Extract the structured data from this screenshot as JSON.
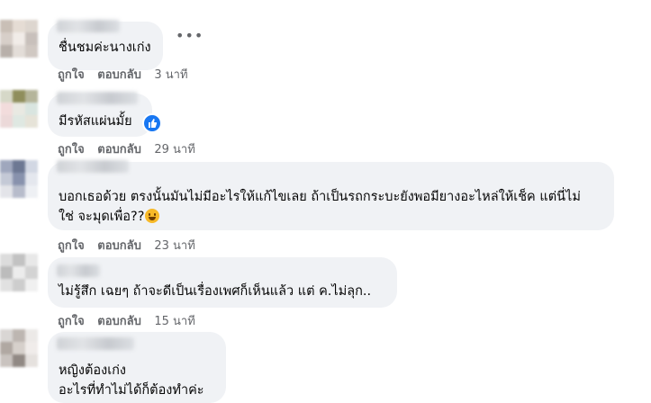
{
  "colors": {
    "bubble": "#f0f2f5",
    "meta": "#65676b",
    "like_blue": "#1877f2"
  },
  "comments": [
    {
      "text_lines": [
        "ชื่นชมค่ะนางเก่ง"
      ],
      "like": "ถูกใจ",
      "reply": "ตอบกลับ",
      "time": "3 นาที",
      "more_icon": "more-options-icon"
    },
    {
      "text_lines": [
        "มีรหัสแผ่นมั้ย"
      ],
      "like": "ถูกใจ",
      "reply": "ตอบกลับ",
      "time": "29 นาที",
      "reaction_icon": "like-reaction-icon"
    },
    {
      "text_lines": [
        "บอกเธอด้วย ตรงนั้นมันไม่มีอะไรให้แก้ไขเลย ถ้าเป็นรถกระบะยังพอมียางอะไหล่ให้เช็ค แต่นี่ไม่",
        "ใช่ จะมุดเพื่อ??"
      ],
      "emoji_icon": "laughing-emoji-icon",
      "like": "ถูกใจ",
      "reply": "ตอบกลับ",
      "time": "23 นาที"
    },
    {
      "text_lines": [
        "ไม่รู้สึก เฉยๆ ถ้าจะดีเป็นเรื่องเพศก็เห็นแล้ว แต่ ค.ไม่ลุก.."
      ],
      "like": "ถูกใจ",
      "reply": "ตอบกลับ",
      "time": "15 นาที"
    },
    {
      "text_lines": [
        "หญิงต้องเก่ง",
        "อะไรที่ทำไม่ได้ก็ต้องทำค่ะ"
      ]
    }
  ]
}
